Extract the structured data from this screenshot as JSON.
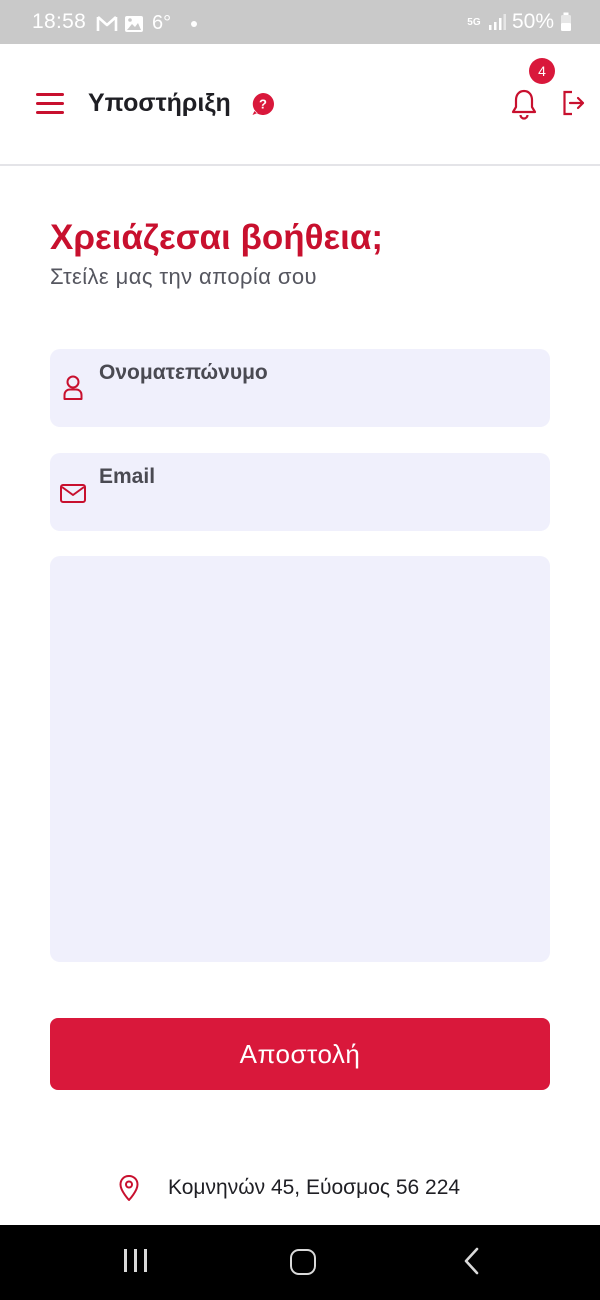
{
  "status_bar": {
    "time": "18:58",
    "temperature": "6°",
    "network": "5G",
    "battery": "50%"
  },
  "header": {
    "title": "Υποστήριξη",
    "help_badge_symbol": "?",
    "notification_count": "4",
    "icons": [
      "menu-icon",
      "help-icon",
      "bell-icon",
      "logout-icon"
    ]
  },
  "page": {
    "heading": "Χρειάζεσαι βοήθεια;",
    "subheading": "Στείλε μας την απορία σου"
  },
  "form": {
    "name_label": "Ονοματεπώνυμο",
    "email_label": "Email",
    "message_value": "",
    "submit_label": "Αποστολή"
  },
  "footer": {
    "address": "Κομνηνών 45, Εύοσμος 56 224"
  },
  "colors": {
    "accent": "#c8102e",
    "button": "#d9183b",
    "field_bg": "#f0f0fc",
    "status_bar_bg": "#c9c9c9"
  }
}
